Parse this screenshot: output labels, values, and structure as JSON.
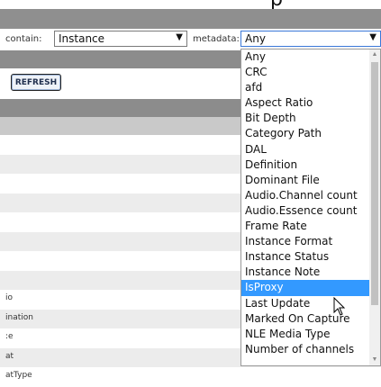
{
  "header": {
    "title_partial": "p"
  },
  "filter": {
    "contain_label": "contain:",
    "contain_value": "Instance",
    "metadata_label": "metadata:",
    "metadata_value": "Any"
  },
  "toolbar": {
    "refresh_label": "REFRESH"
  },
  "rows": [
    "",
    "",
    "",
    "",
    "",
    "",
    "",
    "",
    "io",
    "ination",
    ":e",
    "at",
    "atType"
  ],
  "dropdown": {
    "options": [
      "Any",
      "CRC",
      "afd",
      "Aspect Ratio",
      "Bit Depth",
      "Category Path",
      "DAL",
      "Definition",
      "Dominant File",
      "Audio.Channel count",
      "Audio.Essence count",
      "Frame Rate",
      "Instance Format",
      "Instance Status",
      "Instance Note",
      "IsProxy",
      "Last Update",
      "Marked On Capture",
      "NLE Media Type",
      "Number of channels"
    ],
    "highlighted": "IsProxy"
  },
  "icons": {
    "select_arrow": "chevron-down-icon",
    "scroll_up": "scroll-up-icon",
    "scroll_down": "scroll-down-icon",
    "cursor": "mouse-pointer-icon"
  }
}
